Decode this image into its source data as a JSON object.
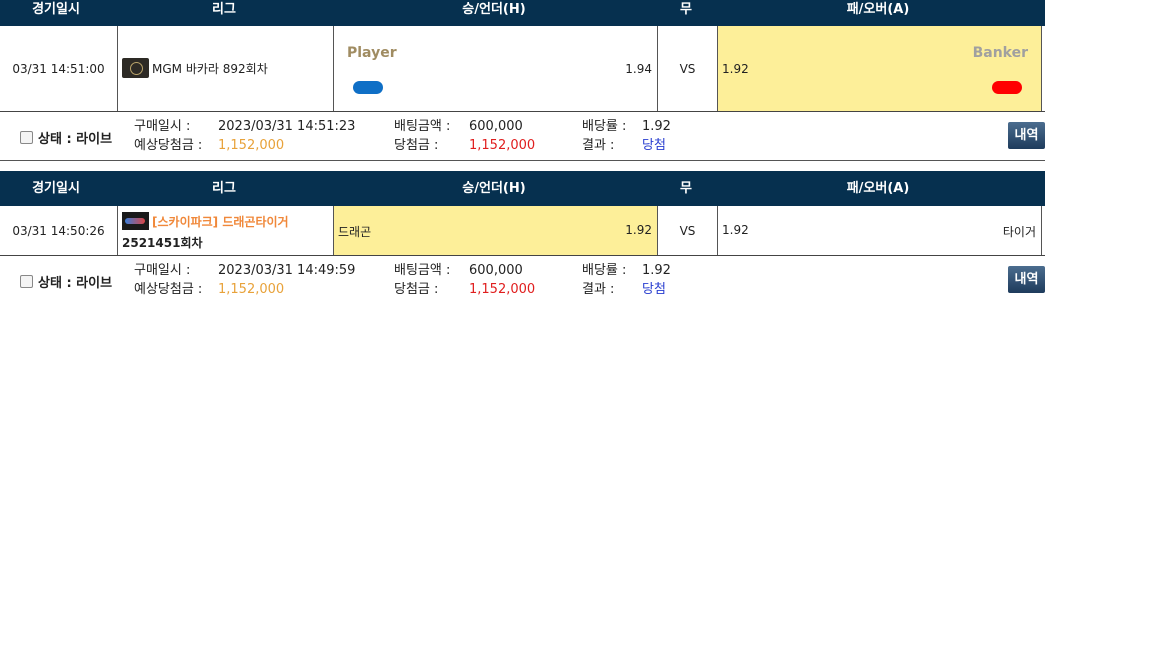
{
  "headers": {
    "date": "경기일시",
    "league": "리그",
    "home": "승/언더(H)",
    "draw": "무",
    "away": "패/오버(A)"
  },
  "bets": [
    {
      "date": "03/31 14:51:00",
      "league": "MGM 바카라 892회차",
      "home_label": "Player",
      "home_odds": "1.94",
      "draw": "VS",
      "away_odds": "1.92",
      "away_label": "Banker",
      "colors": {
        "player": "#0f6fc6",
        "banker": "#ff0000"
      },
      "info": {
        "status": "상태 : 라이브",
        "purchase_label": "구매일시 :",
        "purchase_value": "2023/03/31 14:51:23",
        "bet_label": "배팅금액 :",
        "bet_value": "600,000",
        "rate_label": "배당률 :",
        "rate_value": "1.92",
        "expected_label": "예상당첨금 :",
        "expected_value": "1,152,000",
        "win_label": "당첨금 :",
        "win_value": "1,152,000",
        "result_label": "결과 :",
        "result_value": "당첨",
        "button": "내역"
      }
    },
    {
      "date": "03/31 14:50:26",
      "league": "[스카이파크] 드래곤타이거",
      "league_round": "2521451회차",
      "home_label": "드래곤",
      "home_odds": "1.92",
      "draw": "VS",
      "away_odds": "1.92",
      "away_label": "타이거",
      "info": {
        "status": "상태 : 라이브",
        "purchase_label": "구매일시 :",
        "purchase_value": "2023/03/31 14:49:59",
        "bet_label": "배팅금액 :",
        "bet_value": "600,000",
        "rate_label": "배당률 :",
        "rate_value": "1.92",
        "expected_label": "예상당첨금 :",
        "expected_value": "1,152,000",
        "win_label": "당첨금 :",
        "win_value": "1,152,000",
        "result_label": "결과 :",
        "result_value": "당첨",
        "button": "내역"
      }
    }
  ]
}
